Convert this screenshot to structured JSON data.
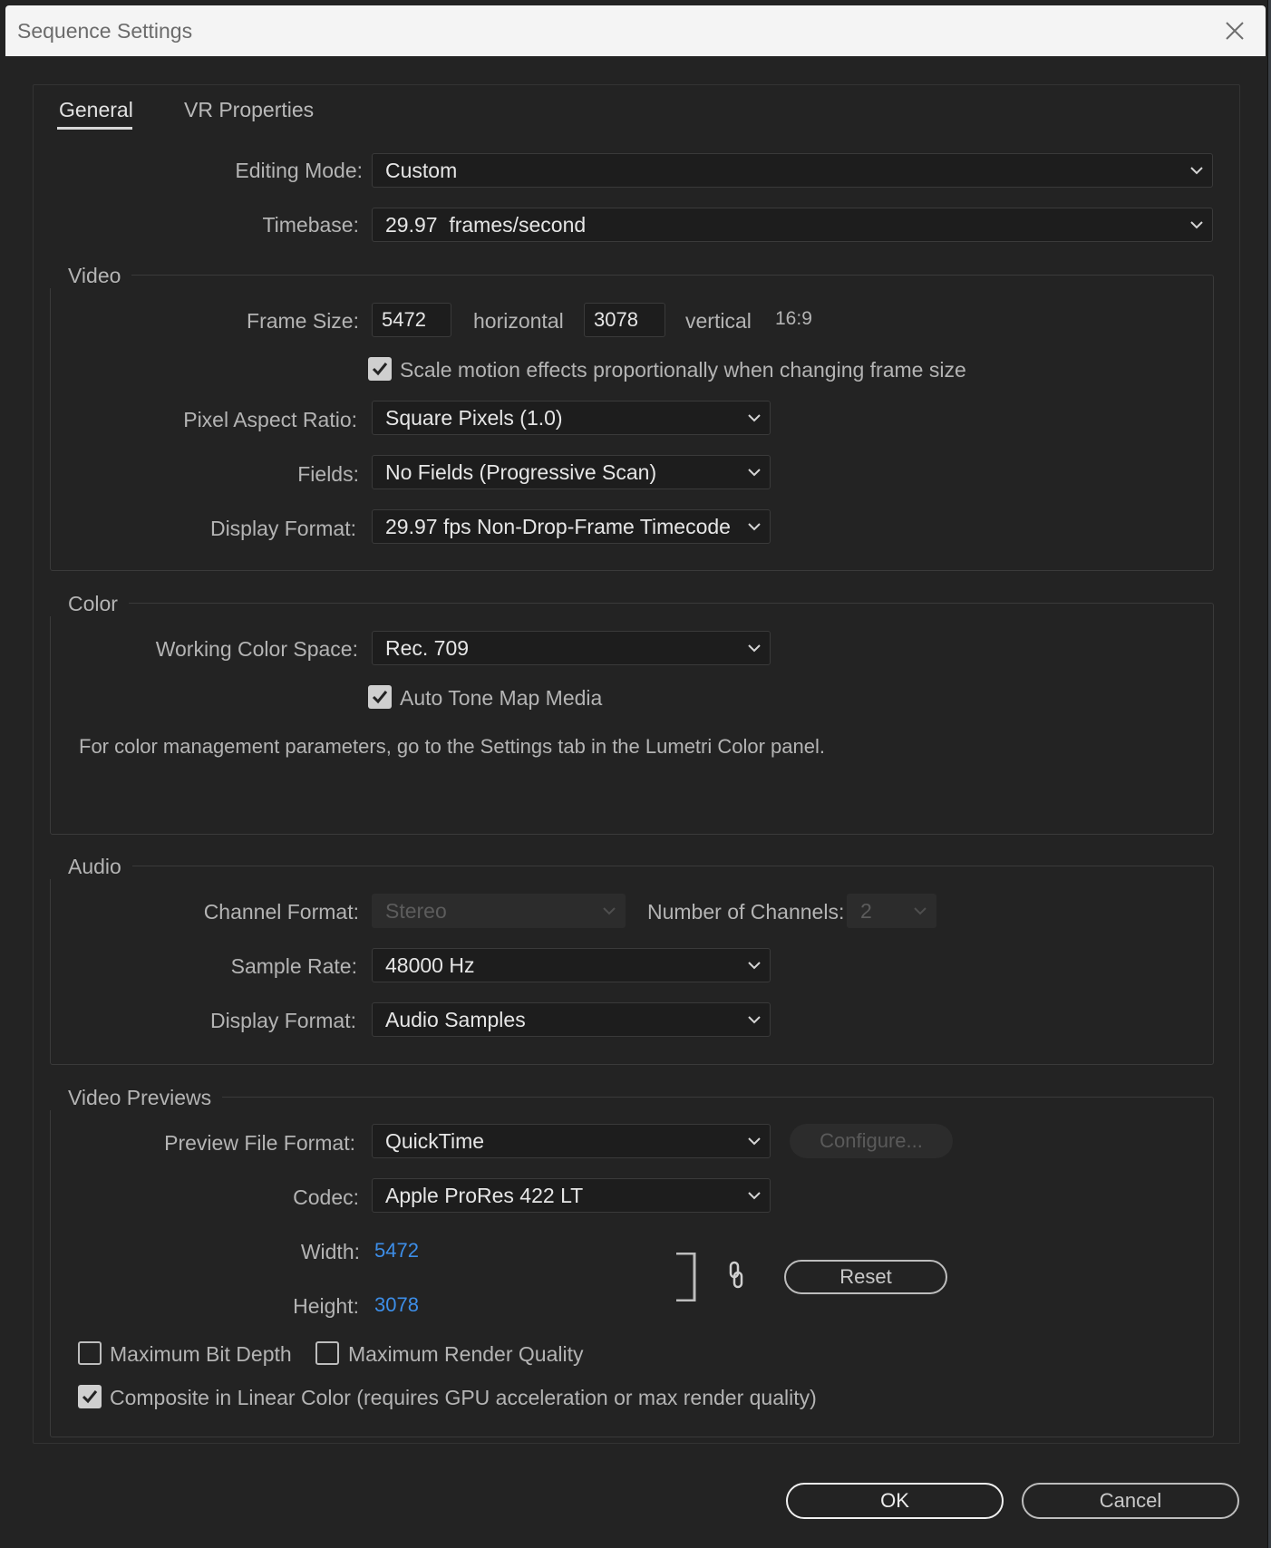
{
  "window": {
    "title": "Sequence Settings"
  },
  "tabs": [
    {
      "label": "General",
      "active": true
    },
    {
      "label": "VR Properties",
      "active": false
    }
  ],
  "general": {
    "editing_mode_label": "Editing Mode:",
    "editing_mode_value": "Custom",
    "timebase_label": "Timebase:",
    "timebase_value": "29.97  frames/second"
  },
  "video": {
    "title": "Video",
    "frame_size_label": "Frame Size:",
    "frame_width": "5472",
    "horizontal_label": "horizontal",
    "frame_height": "3078",
    "vertical_label": "vertical",
    "aspect": "16:9",
    "scale_motion_label": "Scale motion effects proportionally when changing frame size",
    "scale_motion_checked": true,
    "par_label": "Pixel Aspect Ratio:",
    "par_value": "Square Pixels (1.0)",
    "fields_label": "Fields:",
    "fields_value": "No Fields (Progressive Scan)",
    "display_format_label": "Display Format:",
    "display_format_value": "29.97 fps Non-Drop-Frame Timecode"
  },
  "color": {
    "title": "Color",
    "wcs_label": "Working Color Space:",
    "wcs_value": "Rec. 709",
    "auto_tone_label": "Auto Tone Map Media",
    "auto_tone_checked": true,
    "note": "For color management parameters, go to the Settings tab in the Lumetri Color panel."
  },
  "audio": {
    "title": "Audio",
    "channel_format_label": "Channel Format:",
    "channel_format_value": "Stereo",
    "num_channels_label": "Number of Channels:",
    "num_channels_value": "2",
    "sample_rate_label": "Sample Rate:",
    "sample_rate_value": "48000 Hz",
    "display_format_label": "Display Format:",
    "display_format_value": "Audio Samples"
  },
  "previews": {
    "title": "Video Previews",
    "file_format_label": "Preview File Format:",
    "file_format_value": "QuickTime",
    "configure_label": "Configure...",
    "codec_label": "Codec:",
    "codec_value": "Apple ProRes 422 LT",
    "width_label": "Width:",
    "width_value": "5472",
    "height_label": "Height:",
    "height_value": "3078",
    "reset_label": "Reset",
    "max_bit_depth_label": "Maximum Bit Depth",
    "max_bit_depth_checked": false,
    "max_render_quality_label": "Maximum Render Quality",
    "max_render_quality_checked": false,
    "linear_color_label": "Composite in Linear Color (requires GPU acceleration or max render quality)",
    "linear_color_checked": true
  },
  "footer": {
    "ok_label": "OK",
    "cancel_label": "Cancel"
  },
  "icons": {
    "close": "close-icon",
    "chevron": "chevron-down-icon",
    "check": "checkmark-icon",
    "link": "link-chain-icon"
  }
}
